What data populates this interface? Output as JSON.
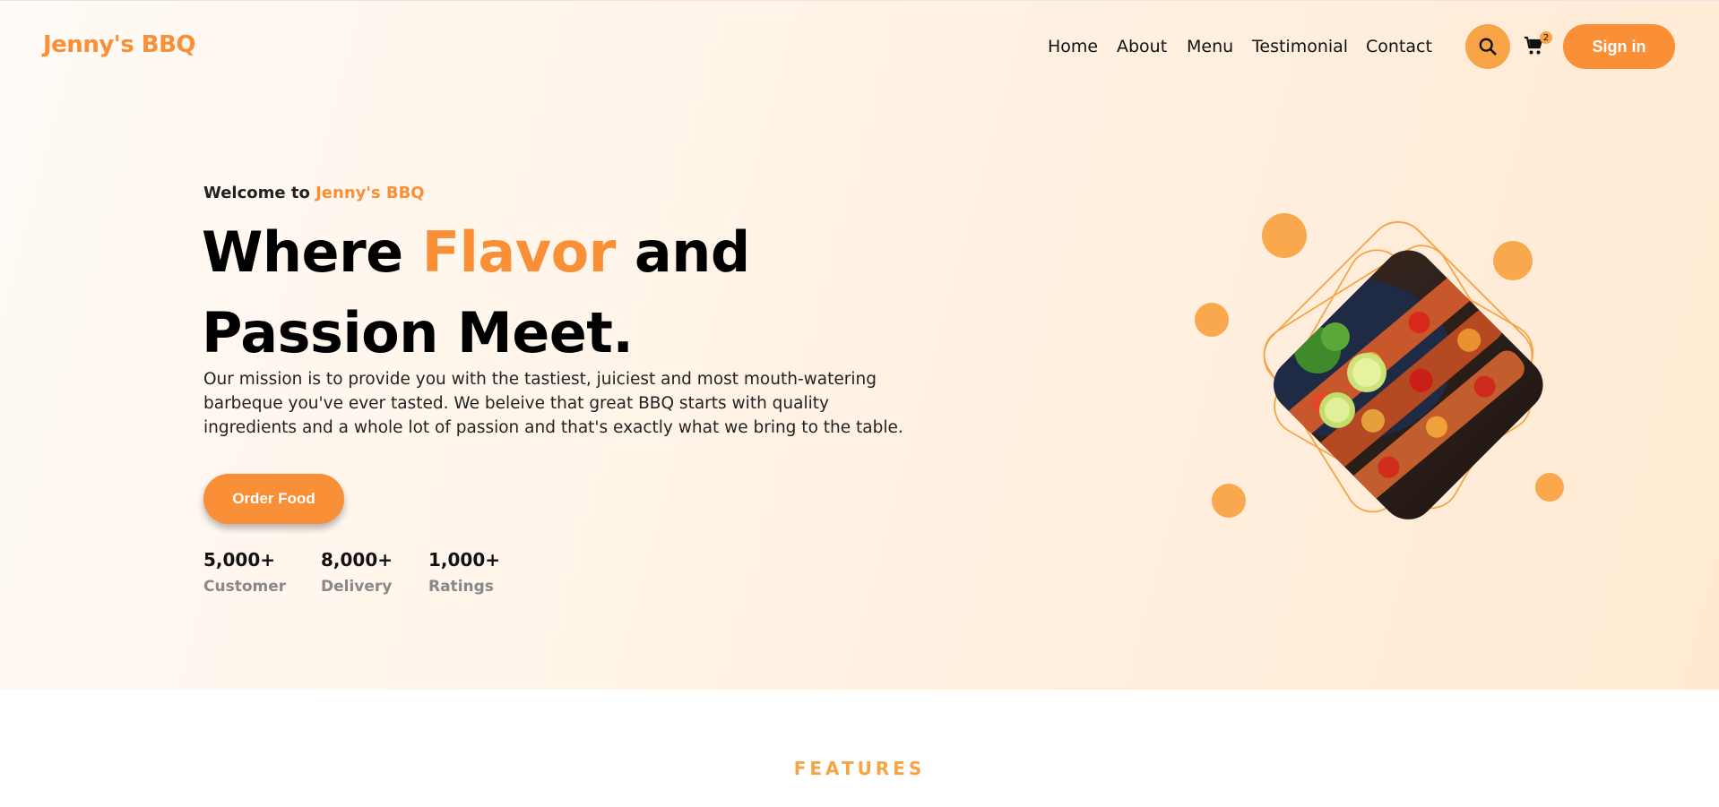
{
  "header": {
    "brand": "Jenny's BBQ",
    "nav": [
      "Home",
      "About",
      "Menu",
      "Testimonial",
      "Contact"
    ],
    "cart_count": "2",
    "signin_label": "Sign in"
  },
  "hero": {
    "welcome_prefix": "Welcome to",
    "welcome_brand": "Jenny's BBQ",
    "headline_part1": "Where",
    "headline_accent": "Flavor",
    "headline_part2": "and",
    "headline_line2": "Passion Meet.",
    "mission": "Our mission is to provide you with the tastiest, juiciest and most mouth-watering barbeque you've ever tasted. We beleive that great BBQ starts with quality ingredients and a whole lot of passion and that's exactly what we bring to the table.",
    "order_label": "Order Food",
    "stats": [
      {
        "value": "5,000+",
        "label": "Customer"
      },
      {
        "value": "8,000+",
        "label": "Delivery"
      },
      {
        "value": "1,000+",
        "label": "Ratings"
      }
    ]
  },
  "features_heading": "FEATURES",
  "colors": {
    "accent": "#f98f36",
    "accent_light": "#f7a447"
  },
  "icons": [
    "search-icon",
    "cart-icon"
  ]
}
